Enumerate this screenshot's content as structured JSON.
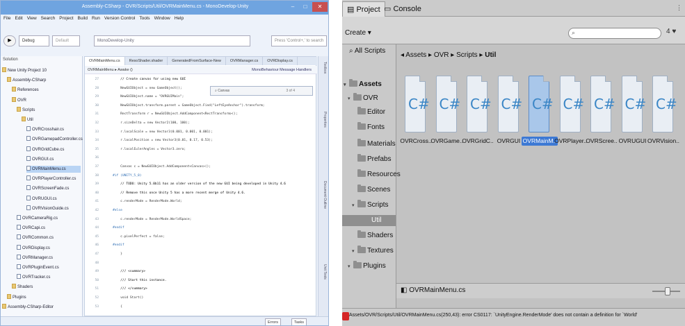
{
  "monodevelop": {
    "title": "Assembly-CSharp - OVR/Scripts/Util/OVRMainMenu.cs - MonoDevelop-Unity",
    "menu": [
      "File",
      "Edit",
      "View",
      "Search",
      "Project",
      "Build",
      "Run",
      "Version Control",
      "Tools",
      "Window",
      "Help"
    ],
    "toolbar": {
      "configuration": "Debug",
      "target": "Default",
      "status": "MonoDevelop-Unity",
      "search_placeholder": "Press 'Control+,' to search"
    },
    "solution": {
      "header": "Solution",
      "items": [
        {
          "label": "New Unity Project 10",
          "indent": 0,
          "folder": true
        },
        {
          "label": "Assembly-CSharp",
          "indent": 1,
          "folder": true
        },
        {
          "label": "References",
          "indent": 2,
          "folder": true
        },
        {
          "label": "OVR",
          "indent": 2,
          "folder": true
        },
        {
          "label": "Scripts",
          "indent": 3,
          "folder": true
        },
        {
          "label": "Util",
          "indent": 4,
          "folder": true
        },
        {
          "label": "OVRCrosshair.cs",
          "indent": 5,
          "folder": false
        },
        {
          "label": "OVRGamepadController.cs",
          "indent": 5,
          "folder": false
        },
        {
          "label": "OVRGridCube.cs",
          "indent": 5,
          "folder": false
        },
        {
          "label": "OVRGUI.cs",
          "indent": 5,
          "folder": false
        },
        {
          "label": "OVRMainMenu.cs",
          "indent": 5,
          "folder": false,
          "selected": true
        },
        {
          "label": "OVRPlayerController.cs",
          "indent": 5,
          "folder": false
        },
        {
          "label": "OVRScreenFade.cs",
          "indent": 5,
          "folder": false
        },
        {
          "label": "OVRUGUI.cs",
          "indent": 5,
          "folder": false
        },
        {
          "label": "OVRVisionGuide.cs",
          "indent": 5,
          "folder": false
        },
        {
          "label": "OVRCameraRig.cs",
          "indent": 3,
          "folder": false
        },
        {
          "label": "OVRCapi.cs",
          "indent": 3,
          "folder": false
        },
        {
          "label": "OVRCommon.cs",
          "indent": 3,
          "folder": false
        },
        {
          "label": "OVRDisplay.cs",
          "indent": 3,
          "folder": false
        },
        {
          "label": "OVRManager.cs",
          "indent": 3,
          "folder": false
        },
        {
          "label": "OVRPluginEvent.cs",
          "indent": 3,
          "folder": false
        },
        {
          "label": "OVRTracker.cs",
          "indent": 3,
          "folder": false
        },
        {
          "label": "Shaders",
          "indent": 2,
          "folder": true
        },
        {
          "label": "Plugins",
          "indent": 1,
          "folder": true
        },
        {
          "label": "Assembly-CSharp-Editor",
          "indent": 0,
          "folder": true
        }
      ]
    },
    "editor": {
      "tabs": [
        "OVRMainMenu.cs",
        "ResoShader.shader",
        "GeneratedFromSurface-New",
        "OVRManager.cs",
        "OVRDisplay.cs"
      ],
      "path_left": "OVRMainMenu",
      "path_member": "Awake ()",
      "path_right": "MonoBehaviour Message Handlers",
      "find_text": "Canvas",
      "find_count": "3 of 4",
      "lines": [
        {
          "n": "27",
          "text": "// Create canvas for using new GUI",
          "kind": "comment"
        },
        {
          "n": "28",
          "text": "NewGUIObject = new GameObject();",
          "kind": "normal"
        },
        {
          "n": "29",
          "text": "NewGUIObject.name = \"OVRGUIMain\";",
          "kind": "normal"
        },
        {
          "n": "30",
          "text": "NewGUIObject.transform.parent = GameObject.Find(\"LeftEyeAnchor\").transform;",
          "kind": "normal"
        },
        {
          "n": "31",
          "text": "RectTransform r = NewGUIObject.AddComponent<RectTransform>();",
          "kind": "normal"
        },
        {
          "n": "32",
          "text": "r.sizeDelta = new Vector2(100, 100);",
          "kind": "normal"
        },
        {
          "n": "33",
          "text": "r.localScale = new Vector3(0.001, 0.001, 0.001);",
          "kind": "normal"
        },
        {
          "n": "34",
          "text": "r.localPosition = new Vector3(0.01, 0.17, 0.53);",
          "kind": "normal"
        },
        {
          "n": "35",
          "text": "r.localEulerAngles = Vector3.zero;",
          "kind": "normal"
        },
        {
          "n": "36",
          "text": "",
          "kind": "normal"
        },
        {
          "n": "37",
          "text": "Canvas c = NewGUIObject.AddComponent<Canvas>();",
          "kind": "normal"
        },
        {
          "n": "38",
          "text": "#if (UNITY_5_0)",
          "kind": "pre"
        },
        {
          "n": "39",
          "text": "// TODO: Unity 5.0b11 has an older version of the new GUI being developed in Unity 4.6",
          "kind": "comment"
        },
        {
          "n": "40",
          "text": "// Remove this once Unity 5 has a more recent merge of Unity 4.6.",
          "kind": "comment"
        },
        {
          "n": "41",
          "text": "c.renderMode = RenderMode.World;",
          "kind": "normal"
        },
        {
          "n": "42",
          "text": "#else",
          "kind": "pre"
        },
        {
          "n": "43",
          "text": "c.renderMode = RenderMode.WorldSpace;",
          "kind": "normal"
        },
        {
          "n": "44",
          "text": "#endif",
          "kind": "pre"
        },
        {
          "n": "45",
          "text": "c.pixelPerfect = false;",
          "kind": "normal"
        },
        {
          "n": "46",
          "text": "#endif",
          "kind": "pre"
        },
        {
          "n": "47",
          "text": "}",
          "kind": "normal"
        },
        {
          "n": "48",
          "text": "",
          "kind": "normal"
        },
        {
          "n": "49",
          "text": "/// <summary>",
          "kind": "comment"
        },
        {
          "n": "50",
          "text": "/// Start this instance.",
          "kind": "comment"
        },
        {
          "n": "51",
          "text": "/// </summary>",
          "kind": "comment"
        },
        {
          "n": "52",
          "text": "void Start()",
          "kind": "normal"
        },
        {
          "n": "53",
          "text": "{",
          "kind": "normal"
        }
      ]
    },
    "right_tabs": [
      "Toolbox",
      "Properties",
      "Document Outline",
      "Unit Tests"
    ],
    "bottom": {
      "errors": "Errors",
      "tasks": "Tasks"
    }
  },
  "unity": {
    "tabs": {
      "project": "Project",
      "console": "Console"
    },
    "create_label": "Create",
    "search_value": "",
    "toolbar_icons": "4 ♥",
    "left_tree": [
      {
        "label": "All Scripts",
        "indent": 0,
        "kind": "search"
      },
      {
        "label": "Assets",
        "indent": 0,
        "kind": "folder",
        "bold": true
      },
      {
        "label": "OVR",
        "indent": 1,
        "kind": "folder"
      },
      {
        "label": "Editor",
        "indent": 2,
        "kind": "folder"
      },
      {
        "label": "Fonts",
        "indent": 2,
        "kind": "folder"
      },
      {
        "label": "Materials",
        "indent": 2,
        "kind": "folder"
      },
      {
        "label": "Prefabs",
        "indent": 2,
        "kind": "folder"
      },
      {
        "label": "Resources",
        "indent": 2,
        "kind": "folder"
      },
      {
        "label": "Scenes",
        "indent": 2,
        "kind": "folder"
      },
      {
        "label": "Scripts",
        "indent": 2,
        "kind": "folder"
      },
      {
        "label": "Util",
        "indent": 3,
        "kind": "folder",
        "selected": true
      },
      {
        "label": "Shaders",
        "indent": 2,
        "kind": "folder"
      },
      {
        "label": "Textures",
        "indent": 2,
        "kind": "folder"
      },
      {
        "label": "Plugins",
        "indent": 1,
        "kind": "folder"
      }
    ],
    "breadcrumb": [
      "Assets",
      "OVR",
      "Scripts",
      "Util"
    ],
    "assets": [
      {
        "label": "OVRCross..",
        "selected": false
      },
      {
        "label": "OVRGame..",
        "selected": false
      },
      {
        "label": "OVRGridC..",
        "selected": false
      },
      {
        "label": "OVRGUI",
        "selected": false
      },
      {
        "label": "OVRMainM..",
        "selected": true
      },
      {
        "label": "OVRPlayer..",
        "selected": false
      },
      {
        "label": "OVRScree..",
        "selected": false
      },
      {
        "label": "OVRUGUI",
        "selected": false
      },
      {
        "label": "OVRVision..",
        "selected": false
      }
    ],
    "asset_glyph": "C#",
    "selected_file": "OVRMainMenu.cs",
    "error": "Assets/OVR/Scripts/Util/OVRMainMenu.cs(250,43): error CS0117: `UnityEngine.RenderMode' does not contain a definition for `World'"
  },
  "colors": {
    "accent": "#3d79d4",
    "error": "#d52525",
    "titlebar": "#6fa4e0"
  }
}
